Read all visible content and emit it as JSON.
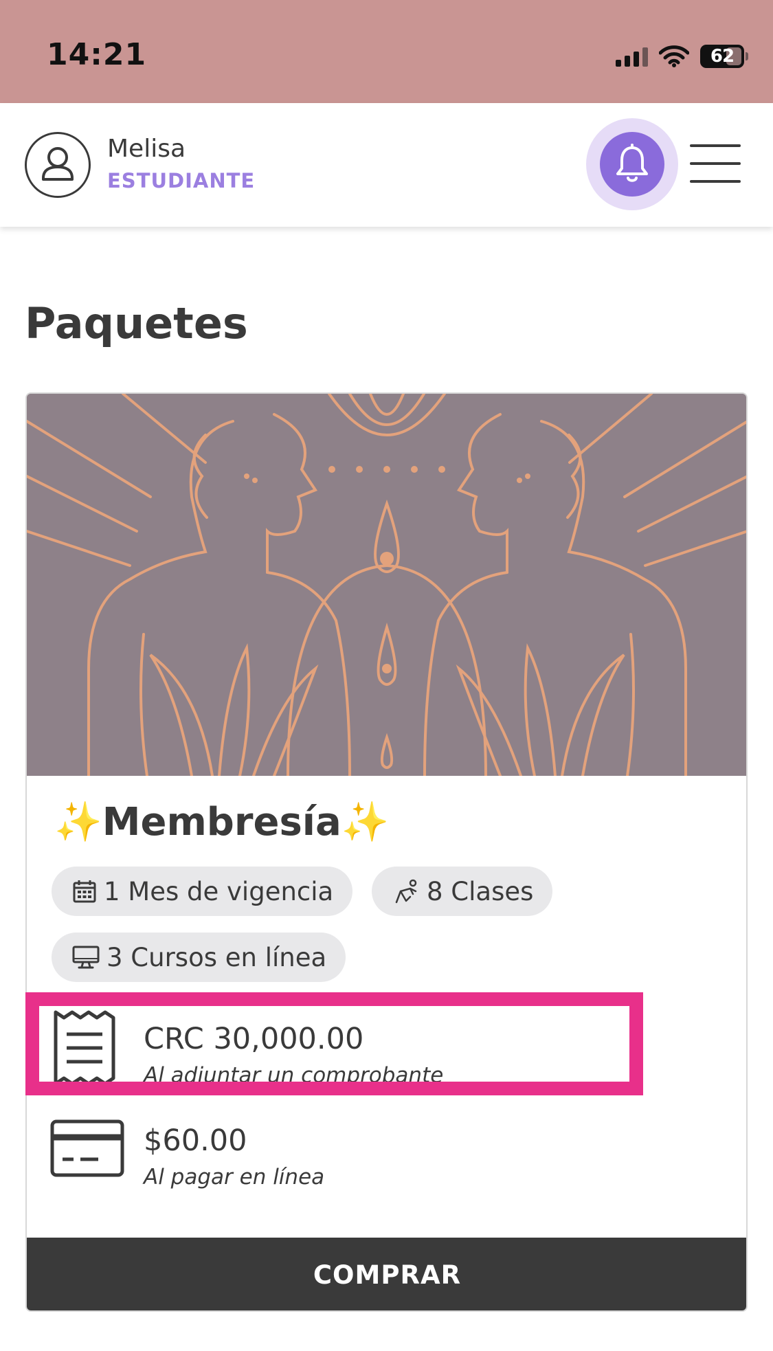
{
  "status_bar": {
    "time": "14:21",
    "battery": "62"
  },
  "header": {
    "user_name": "Melisa",
    "user_role": "ESTUDIANTE"
  },
  "page": {
    "title": "Paquetes"
  },
  "package": {
    "title": "Membresía",
    "chips": {
      "validity": "1 Mes de vigencia",
      "classes": "8 Clases",
      "courses": "3 Cursos en línea"
    },
    "prices": [
      {
        "amount": "CRC 30,000.00",
        "note": "Al adjuntar un comprobante",
        "icon": "receipt-icon"
      },
      {
        "amount": "$60.00",
        "note": "Al pagar en línea",
        "icon": "credit-card-icon"
      }
    ],
    "buy_label": "COMPRAR"
  },
  "colors": {
    "status_bar_bg": "#c99593",
    "accent_purple": "#8a6bdb",
    "role_purple": "#9b7fe0",
    "highlight_pink": "#e8308a",
    "button_dark": "#3a3a3a",
    "artwork_bg": "#8e8189",
    "artwork_line": "#e3a27c"
  }
}
